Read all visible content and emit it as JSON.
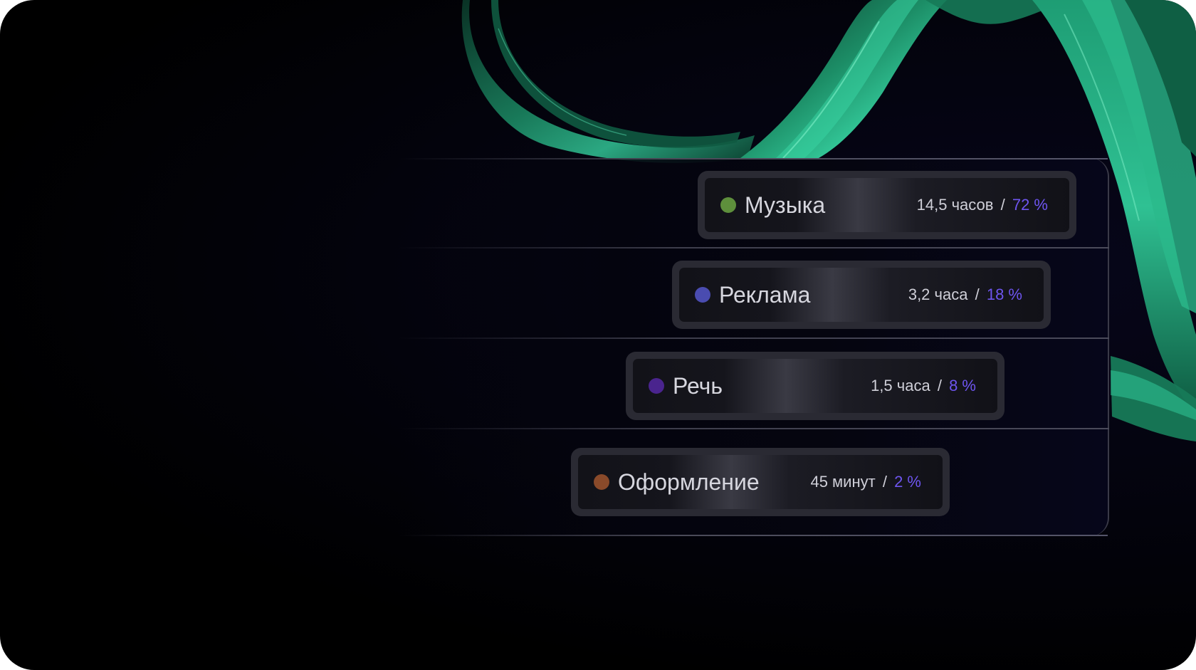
{
  "colors": {
    "music": "#5e8f3c",
    "ads": "#4a4cb0",
    "speech": "#4a248e",
    "design": "#8a4a2a",
    "percent": "#6e55f0",
    "ribbon": "#1fa57a"
  },
  "categories": [
    {
      "name": "Музыка",
      "duration": "14,5 часов",
      "separator": "/",
      "percent": "72 %",
      "dot_color": "#5e8f3c"
    },
    {
      "name": "Реклама",
      "duration": "3,2 часа",
      "separator": "/",
      "percent": "18 %",
      "dot_color": "#4a4cb0"
    },
    {
      "name": "Речь",
      "duration": "1,5 часа",
      "separator": "/",
      "percent": "8 %",
      "dot_color": "#4a248e"
    },
    {
      "name": "Оформление",
      "duration": "45 минут",
      "separator": "/",
      "percent": "2 %",
      "dot_color": "#8a4a2a"
    }
  ]
}
